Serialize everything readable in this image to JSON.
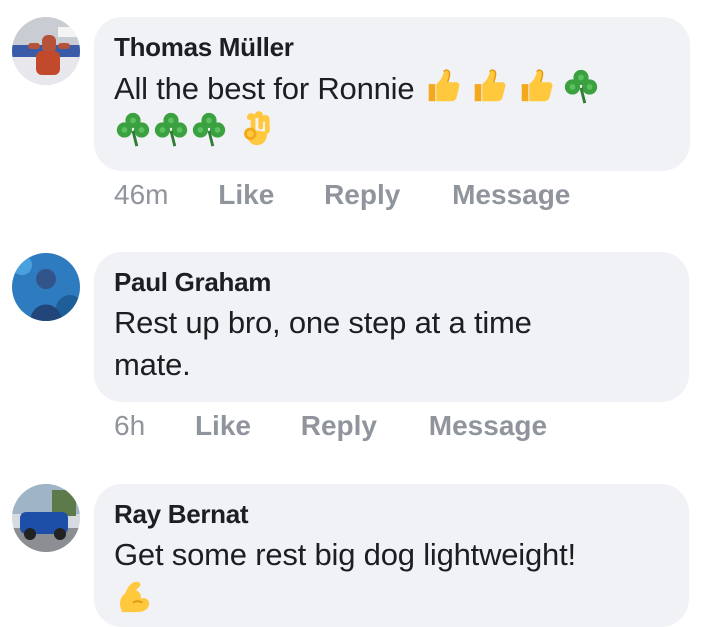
{
  "comments": [
    {
      "author": "Thomas Müller",
      "text_line1": "All the best for Ronnie",
      "emojis_line1": [
        "thumbs-up",
        "thumbs-up",
        "thumbs-up",
        "shamrock"
      ],
      "emojis_line2": [
        "shamrock",
        "shamrock",
        "shamrock",
        "ok-hand"
      ],
      "time": "46m",
      "like": "Like",
      "reply": "Reply",
      "message": "Message"
    },
    {
      "author": "Paul Graham",
      "text_line1": "Rest up bro, one step at a time",
      "text_line2": "mate.",
      "time": "6h",
      "like": "Like",
      "reply": "Reply",
      "message": "Message"
    },
    {
      "author": "Ray Bernat",
      "text_line1": "Get some rest big dog lightweight!",
      "emojis_line2": [
        "flexed-biceps"
      ]
    }
  ],
  "colors": {
    "bubble_bg": "#f0f2f5",
    "text": "#1c1e21",
    "meta": "#90949c"
  }
}
